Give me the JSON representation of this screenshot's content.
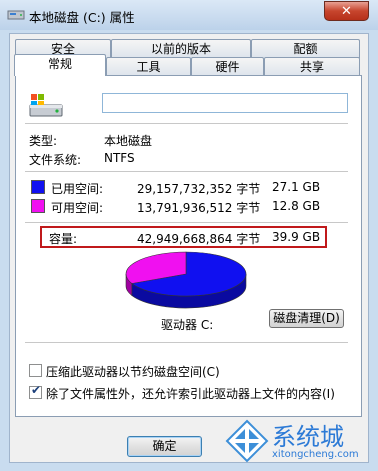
{
  "window": {
    "title": "本地磁盘 (C:) 属性",
    "close_label": "✕"
  },
  "tabs_top": [
    {
      "label": "安全"
    },
    {
      "label": "以前的版本"
    },
    {
      "label": "配额"
    }
  ],
  "tabs_bottom": [
    {
      "label": "常规",
      "active": true
    },
    {
      "label": "工具"
    },
    {
      "label": "硬件"
    },
    {
      "label": "共享"
    }
  ],
  "general": {
    "name_value": "",
    "type_label": "类型:",
    "type_value": "本地磁盘",
    "fs_label": "文件系统:",
    "fs_value": "NTFS",
    "used_label": "已用空间:",
    "used_bytes": "29,157,732,352 字节",
    "used_size": "27.1 GB",
    "free_label": "可用空间:",
    "free_bytes": "13,791,936,512 字节",
    "free_size": "12.8 GB",
    "capacity_label": "容量:",
    "capacity_bytes": "42,949,668,864 字节",
    "capacity_size": "39.9 GB",
    "drive_label": "驱动器 C:",
    "cleanup_button": "磁盘清理(D)",
    "compress_label": "压缩此驱动器以节约磁盘空间(C)",
    "compress_checked": false,
    "index_label": "除了文件属性外，还允许索引此驱动器上文件的内容(I)",
    "index_checked": true,
    "used_fraction": 0.679,
    "colors": {
      "used": "#1010f0",
      "free": "#f010f0"
    }
  },
  "footer": {
    "ok_button": "确定"
  },
  "watermark": {
    "text": "系统城",
    "url": "xitongcheng.com"
  }
}
